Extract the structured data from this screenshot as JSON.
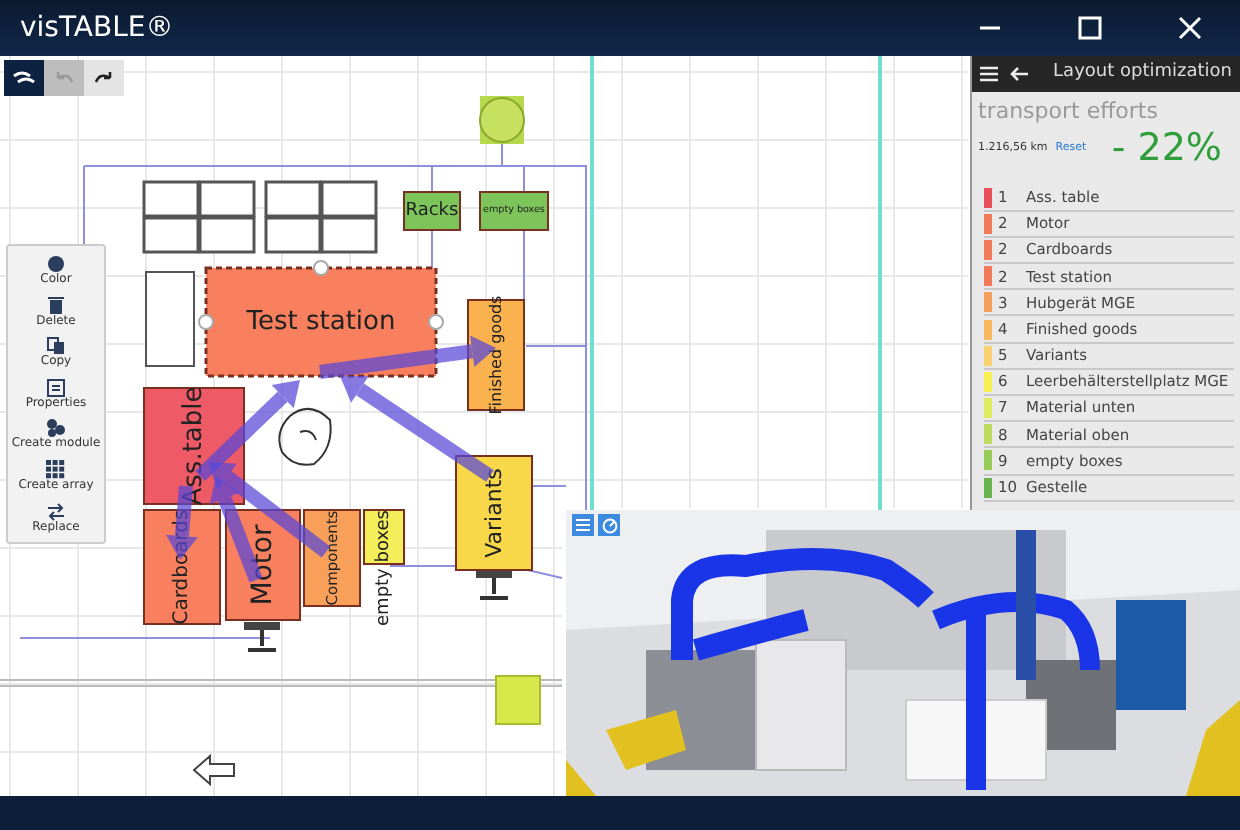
{
  "window": {
    "title": "visTABLE®"
  },
  "toolbar": [
    {
      "kind": "view",
      "active": true,
      "disabled": false
    },
    {
      "kind": "undo",
      "active": false,
      "disabled": true
    },
    {
      "kind": "redo",
      "active": false,
      "disabled": false
    }
  ],
  "context_menu": [
    {
      "kind": "color",
      "label": "Color"
    },
    {
      "kind": "delete",
      "label": "Delete"
    },
    {
      "kind": "copy",
      "label": "Copy"
    },
    {
      "kind": "properties",
      "label": "Properties"
    },
    {
      "kind": "module",
      "label": "Create module"
    },
    {
      "kind": "array",
      "label": "Create array"
    },
    {
      "kind": "replace",
      "label": "Replace"
    }
  ],
  "diagram": {
    "stations": [
      {
        "label": "Test station",
        "color": "#f8805e",
        "kind": "horizontal",
        "selected": true
      },
      {
        "label": "Racks",
        "color": "#7dc45a",
        "kind": "horizontal",
        "selected": false
      },
      {
        "label": "empty boxes",
        "color": "#7dc45a",
        "kind": "horizontal",
        "selected": false
      },
      {
        "label": "Finished goods",
        "color": "#f9b24e",
        "kind": "vertical",
        "selected": false
      },
      {
        "label": "Ass.table",
        "color": "#ee5a66",
        "kind": "vertical",
        "selected": false
      },
      {
        "label": "Cardboards",
        "color": "#f8805e",
        "kind": "vertical",
        "selected": false
      },
      {
        "label": "Motor",
        "color": "#f8805e",
        "kind": "vertical",
        "selected": false
      },
      {
        "label": "Components",
        "color": "#f8a05a",
        "kind": "vertical",
        "selected": false
      },
      {
        "label": "empty boxes",
        "color": "#f4ee5a",
        "kind": "vertical",
        "selected": false
      },
      {
        "label": "Variants",
        "color": "#f8d848",
        "kind": "vertical",
        "selected": false
      }
    ]
  },
  "side_panel": {
    "title": "Layout optimization",
    "heading": "transport efforts",
    "distance": "1.216,56 km",
    "reset": "Reset",
    "saving": "- 22%",
    "items": [
      {
        "rank": "1",
        "name": "Ass. table",
        "color": "#e8505a"
      },
      {
        "rank": "2",
        "name": "Motor",
        "color": "#f07a5a"
      },
      {
        "rank": "2",
        "name": "Cardboards",
        "color": "#f07a5a"
      },
      {
        "rank": "2",
        "name": "Test station",
        "color": "#f07a5a"
      },
      {
        "rank": "3",
        "name": "Hubgerät MGE",
        "color": "#f5a05a"
      },
      {
        "rank": "4",
        "name": "Finished goods",
        "color": "#f8b860"
      },
      {
        "rank": "5",
        "name": "Variants",
        "color": "#fad070"
      },
      {
        "rank": "6",
        "name": "Leerbehälterstellplatz MGE",
        "color": "#f6f050"
      },
      {
        "rank": "7",
        "name": "Material unten",
        "color": "#e0ec60"
      },
      {
        "rank": "8",
        "name": "Material oben",
        "color": "#c0dc60"
      },
      {
        "rank": "9",
        "name": "empty boxes",
        "color": "#98cc58"
      },
      {
        "rank": "10",
        "name": "Gestelle",
        "color": "#6ab450"
      }
    ]
  }
}
